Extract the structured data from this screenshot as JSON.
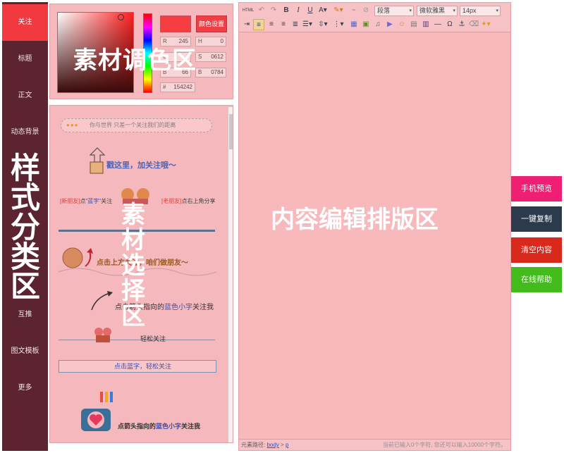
{
  "sidebar": {
    "items": [
      {
        "label": "关注",
        "active": true
      },
      {
        "label": "标题"
      },
      {
        "label": "正文"
      },
      {
        "label": "动态背景"
      },
      {
        "label": "互推"
      },
      {
        "label": "图文模板"
      },
      {
        "label": "更多"
      }
    ],
    "overlay_label": "样式分类区"
  },
  "palette": {
    "overlay_label": "素材调色区",
    "set_button": "颜色设置",
    "fields": {
      "r": {
        "label": "R",
        "value": "245"
      },
      "g": {
        "label": "G",
        "value": ""
      },
      "b": {
        "label": "B",
        "value": "66"
      },
      "h": {
        "label": "H",
        "value": "0"
      },
      "s": {
        "label": "S",
        "value": "0612"
      },
      "b2": {
        "label": "B",
        "value": "0784"
      },
      "hex": {
        "label": "#",
        "value": "154242"
      }
    },
    "current_color": "#f53d42"
  },
  "materials": {
    "overlay_label": "素材选择区",
    "m1": "你与世界  只差一个关注我们的距离",
    "m2": "戳这里，加关注哦～",
    "m3": {
      "a": "[新朋友]",
      "mid": "点",
      "b": "\"蓝字\"",
      "tail": "关注"
    },
    "m3r": {
      "a": "[老朋友]",
      "tail": "点右上角分享"
    },
    "m4": "点击上方关注，咱们做朋友～",
    "m5": {
      "pre": "点击箭头指向的",
      "b": "蓝色小字",
      "tail": "关注我"
    },
    "m6": "轻松关注",
    "m7": "点击蓝字，轻松关注",
    "m8": {
      "pre": "点箭头指向的",
      "b": "蓝色小字",
      "tail": "关注我"
    }
  },
  "editor": {
    "overlay_label": "内容编辑排版区",
    "toolbar": {
      "paragraph_select": "段落",
      "font_select": "微软雅黑",
      "size_select": "14px",
      "html_label": "HTML"
    },
    "status": {
      "path_label": "元素路径:",
      "path_body": "body",
      "path_sep": " > ",
      "path_p": "p",
      "count_text": "当前已输入0个字符, 您还可以输入10000个字符。"
    }
  },
  "actions": [
    {
      "label": "手机预览",
      "color": "#ef1f74"
    },
    {
      "label": "一键复制",
      "color": "#2b3b4c"
    },
    {
      "label": "清空内容",
      "color": "#d9281c"
    },
    {
      "label": "在线帮助",
      "color": "#44bb1c"
    }
  ]
}
